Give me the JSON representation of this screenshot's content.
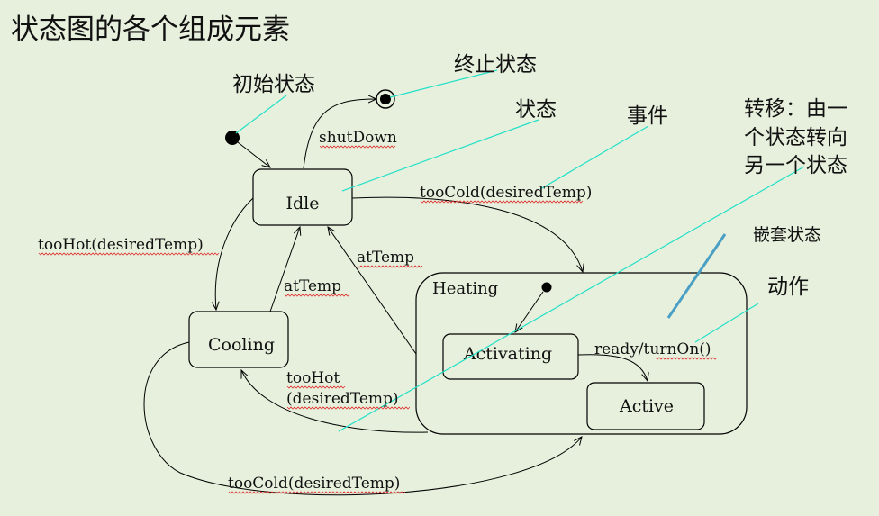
{
  "title": "状态图的各个组成元素",
  "callouts": {
    "initial": "初始状态",
    "final": "终止状态",
    "state": "状态",
    "event": "事件",
    "transition_1": "转移：由一",
    "transition_2": "个状态转向",
    "transition_3": "另一个状态",
    "nested": "嵌套状态",
    "action": "动作"
  },
  "states": {
    "idle": "Idle",
    "cooling": "Cooling",
    "heating": "Heating",
    "activating": "Activating",
    "active": "Active"
  },
  "transitions": {
    "shutdown": "shutDown",
    "toocold_top": "tooCold(desiredTemp)",
    "toohot_left": "tooHot(desiredTemp)",
    "attemp_cooling": "atTemp",
    "attemp_heating": "atTemp",
    "toohot_bottom_1": "tooHot",
    "toohot_bottom_2": "(desiredTemp)",
    "ready": "ready/turnOn()",
    "toocold_bottom": "tooCold(desiredTemp)"
  },
  "colors": {
    "background": "#e6f0dc",
    "callout_line": "#22e0c8",
    "nested_marker": "#4a9fc4"
  }
}
